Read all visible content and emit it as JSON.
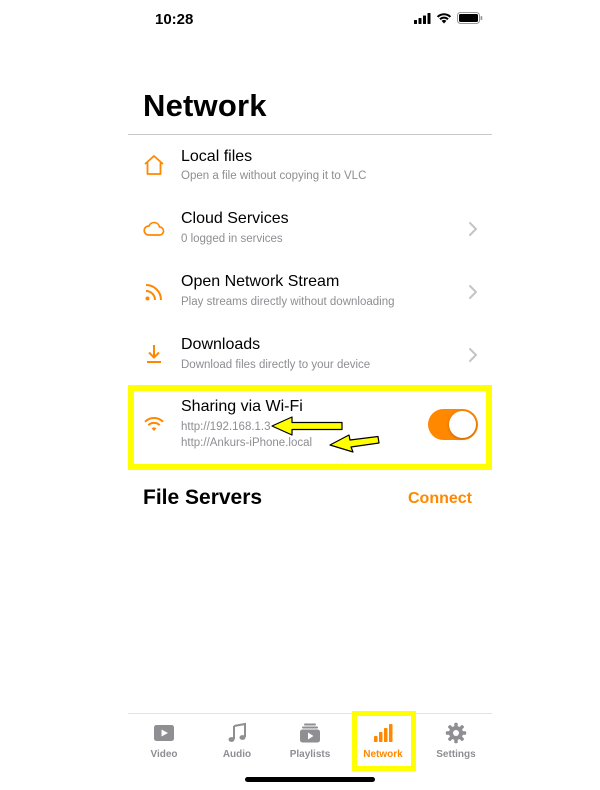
{
  "status_bar": {
    "time": "10:28"
  },
  "page": {
    "title": "Network"
  },
  "rows": [
    {
      "icon": "home-icon",
      "title": "Local files",
      "subtitle": "Open a file without copying it to VLC",
      "has_chevron": false
    },
    {
      "icon": "cloud-icon",
      "title": "Cloud Services",
      "subtitle": "0 logged in services",
      "has_chevron": true
    },
    {
      "icon": "rss-icon",
      "title": "Open Network Stream",
      "subtitle": "Play streams directly without downloading",
      "has_chevron": true
    },
    {
      "icon": "download-icon",
      "title": "Downloads",
      "subtitle": "Download files directly to your device",
      "has_chevron": true
    }
  ],
  "wifi_sharing": {
    "title": "Sharing via Wi-Fi",
    "address_ip": "http://192.168.1.3",
    "address_host": "http://Ankurs-iPhone.local",
    "enabled": true
  },
  "file_servers": {
    "title": "File Servers",
    "connect_label": "Connect"
  },
  "tabs": [
    {
      "label": "Video",
      "icon": "video-icon",
      "active": false
    },
    {
      "label": "Audio",
      "icon": "music-note-icon",
      "active": false
    },
    {
      "label": "Playlists",
      "icon": "playlist-icon",
      "active": false
    },
    {
      "label": "Network",
      "icon": "signal-bars-icon",
      "active": true
    },
    {
      "label": "Settings",
      "icon": "gear-icon",
      "active": false
    }
  ],
  "colors": {
    "accent": "#ff8800",
    "highlight": "#ffff00",
    "secondary_text": "#8e8e93"
  }
}
